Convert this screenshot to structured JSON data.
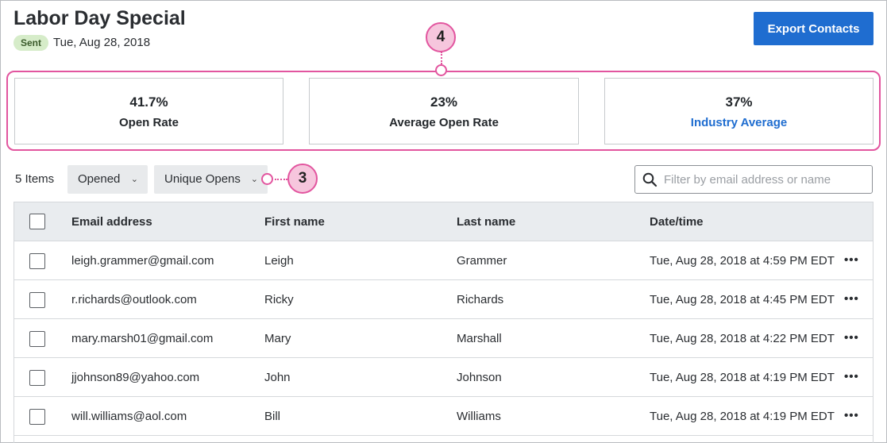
{
  "campaign": {
    "title": "Labor Day Special",
    "status_badge": "Sent",
    "sent_date": "Tue, Aug 28, 2018"
  },
  "actions": {
    "export_label": "Export Contacts"
  },
  "stats": [
    {
      "value": "41.7%",
      "label": "Open Rate",
      "is_link": false
    },
    {
      "value": "23%",
      "label": "Average Open Rate",
      "is_link": false
    },
    {
      "value": "37%",
      "label": "Industry Average",
      "is_link": true
    }
  ],
  "callouts": {
    "stats_marker": "4",
    "filter_marker": "3"
  },
  "toolbar": {
    "items_count": "5 Items",
    "filter_opened": "Opened",
    "filter_unique": "Unique Opens",
    "search_placeholder": "Filter by email address or name"
  },
  "table": {
    "columns": [
      "Email address",
      "First name",
      "Last name",
      "Date/time"
    ],
    "rows": [
      {
        "email": "leigh.grammer@gmail.com",
        "first": "Leigh",
        "last": "Grammer",
        "datetime": "Tue, Aug 28, 2018 at 4:59 PM EDT"
      },
      {
        "email": "r.richards@outlook.com",
        "first": "Ricky",
        "last": "Richards",
        "datetime": "Tue, Aug 28, 2018 at 4:45 PM EDT"
      },
      {
        "email": "mary.marsh01@gmail.com",
        "first": "Mary",
        "last": "Marshall",
        "datetime": "Tue, Aug 28, 2018 at 4:22 PM EDT"
      },
      {
        "email": "jjohnson89@yahoo.com",
        "first": "John",
        "last": "Johnson",
        "datetime": "Tue, Aug 28, 2018 at 4:19 PM EDT"
      },
      {
        "email": "will.williams@aol.com",
        "first": "Bill",
        "last": "Williams",
        "datetime": "Tue, Aug 28, 2018 at 4:19 PM EDT"
      }
    ],
    "row_menu_glyph": "•••"
  },
  "colors": {
    "accent_blue": "#1f6dd0",
    "callout_pink": "#e2559f",
    "sent_green": "#d6ecc9"
  }
}
